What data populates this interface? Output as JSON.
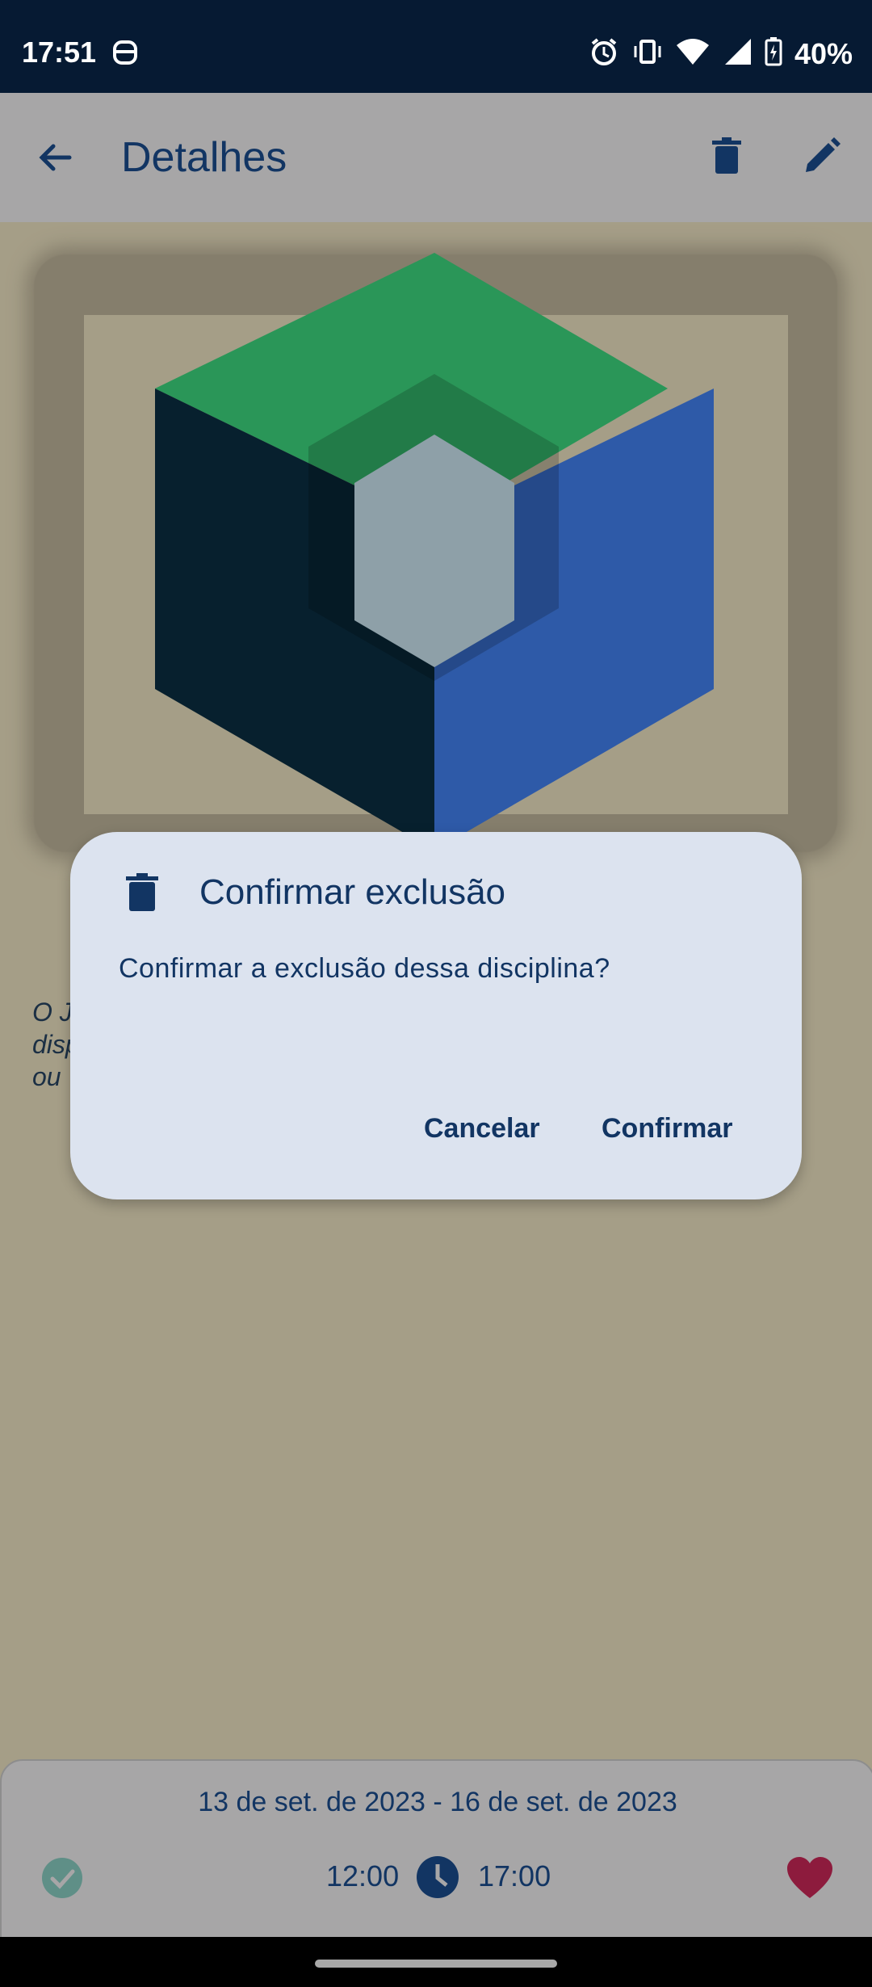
{
  "status_bar": {
    "time": "17:51",
    "battery": "40%",
    "icons": [
      "android-head-icon",
      "alarm-icon",
      "vibrate-icon",
      "wifi-icon",
      "signal-icon",
      "battery-charging-icon"
    ]
  },
  "app_bar": {
    "title": "Detalhes",
    "icons": [
      "back-arrow-icon",
      "trash-icon",
      "pencil-icon"
    ]
  },
  "description": {
    "text": "O J\ndisp\nou "
  },
  "dialog": {
    "icon": "trash-icon",
    "title": "Confirmar exclusão",
    "message": "Confirmar a exclusão dessa disciplina?",
    "cancel_label": "Cancelar",
    "confirm_label": "Confirmar"
  },
  "bottom_panel": {
    "date_range": "13 de set. de 2023 - 16 de set. de 2023",
    "start_time": "12:00",
    "end_time": "17:00",
    "icons": [
      "check-circle-icon",
      "clock-icon",
      "heart-icon"
    ]
  },
  "colors": {
    "primary": "#123563",
    "status_bar": "#061a33",
    "app_bar": "#a7a6a7",
    "background": "#a59e87",
    "dialog_bg": "#dce3ef",
    "logo_green": "#2a9658",
    "logo_blue": "#2e5aa8",
    "logo_dark": "#07202e",
    "logo_center": "#8ea0a8",
    "heart": "#8d1b3d",
    "check": "#5f8f87"
  }
}
